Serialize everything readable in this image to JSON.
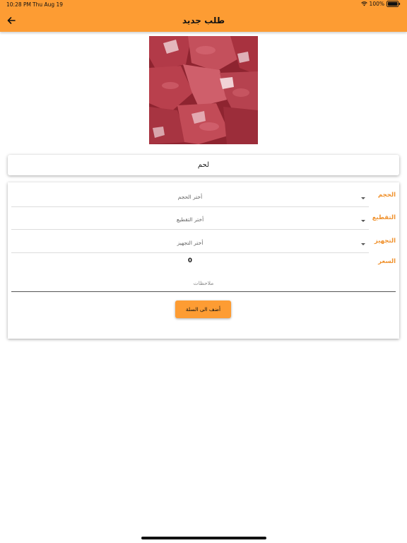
{
  "status_bar": {
    "time": "10:28 PM",
    "date": "Thu Aug 19",
    "battery_percent": "100%"
  },
  "header": {
    "title": "طلب جديد",
    "back_icon": "arrow-left-icon"
  },
  "product": {
    "image": "raw-meat-cubes-photo",
    "name": "لحم"
  },
  "form": {
    "size": {
      "label": "الحجم",
      "placeholder": "أختر الحجم"
    },
    "cutting": {
      "label": "التقطيع",
      "placeholder": "أختر التقطيع"
    },
    "preparation": {
      "label": "التجهيز",
      "placeholder": "أختر التجهيز"
    },
    "price": {
      "label": "السعر",
      "value": "0"
    },
    "notes": {
      "placeholder": "ملاحظات",
      "value": ""
    },
    "add_to_cart_label": "أضف الى السلة"
  },
  "colors": {
    "accent": "#fd9c33",
    "label_orange": "#f0922e"
  }
}
